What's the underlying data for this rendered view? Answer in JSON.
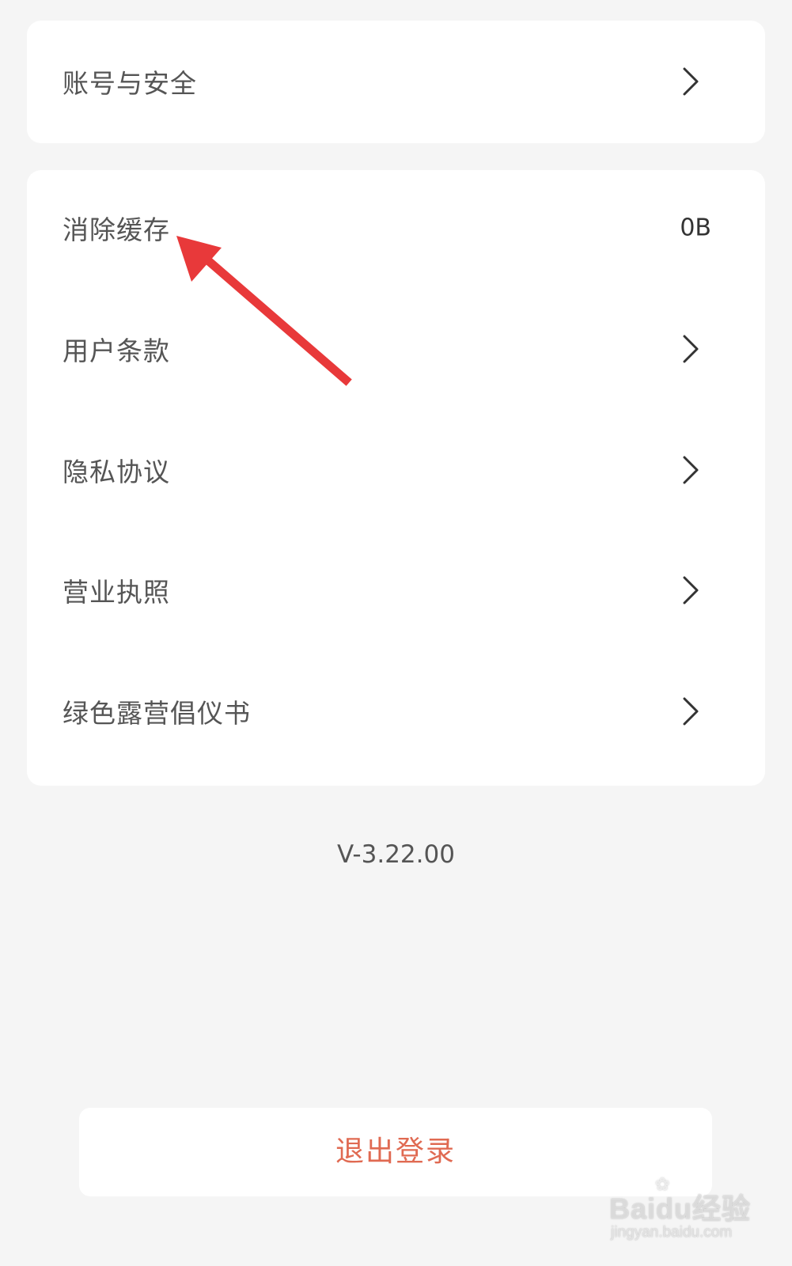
{
  "settings": {
    "account_security": "账号与安全",
    "clear_cache": {
      "label": "消除缓存",
      "value": "0B"
    },
    "user_terms": "用户条款",
    "privacy_policy": "隐私协议",
    "business_license": "营业执照",
    "green_camping_initiative": "绿色露营倡仪书"
  },
  "version": "V-3.22.00",
  "logout_label": "退出登录",
  "watermark": {
    "brand": "Baidu经验",
    "url": "jingyan.baidu.com"
  },
  "colors": {
    "background": "#f5f5f5",
    "card": "#ffffff",
    "logout_text": "#e06a52",
    "annotation_arrow": "#e8393a"
  },
  "icons": {
    "row_chevron": "chevron-right-icon",
    "annotation": "red-arrow-annotation"
  }
}
